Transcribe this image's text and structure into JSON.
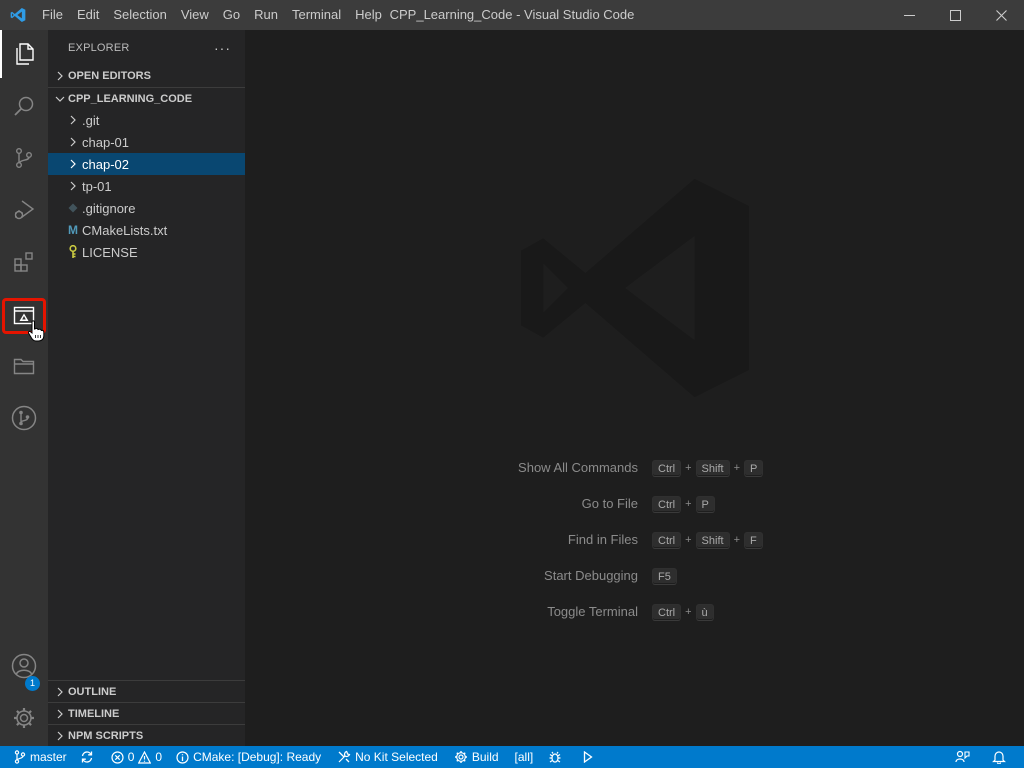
{
  "window": {
    "title": "CPP_Learning_Code - Visual Studio Code"
  },
  "menu": [
    "File",
    "Edit",
    "Selection",
    "View",
    "Go",
    "Run",
    "Terminal",
    "Help"
  ],
  "activitybar": {
    "items": [
      "explorer-icon",
      "search-icon",
      "source-control-icon",
      "run-debug-icon",
      "extensions-icon",
      "cmake-icon",
      "folder-icon",
      "git-graph-icon"
    ],
    "accounts_badge": "1"
  },
  "sidebar": {
    "header": "EXPLORER",
    "more": "···",
    "open_editors": "OPEN EDITORS",
    "folder_name": "CPP_LEARNING_CODE",
    "tree": [
      {
        "label": ".git",
        "kind": "folder"
      },
      {
        "label": "chap-01",
        "kind": "folder"
      },
      {
        "label": "chap-02",
        "kind": "folder",
        "selected": true
      },
      {
        "label": "tp-01",
        "kind": "folder"
      },
      {
        "label": ".gitignore",
        "kind": "file"
      },
      {
        "label": "CMakeLists.txt",
        "kind": "file",
        "icon": "M"
      },
      {
        "label": "LICENSE",
        "kind": "file"
      }
    ],
    "bottom_sections": [
      "OUTLINE",
      "TIMELINE",
      "NPM SCRIPTS"
    ]
  },
  "editor": {
    "shortcuts": [
      {
        "label": "Show All Commands",
        "keys": [
          "Ctrl",
          "Shift",
          "P"
        ]
      },
      {
        "label": "Go to File",
        "keys": [
          "Ctrl",
          "P"
        ]
      },
      {
        "label": "Find in Files",
        "keys": [
          "Ctrl",
          "Shift",
          "F"
        ]
      },
      {
        "label": "Start Debugging",
        "keys": [
          "F5"
        ]
      },
      {
        "label": "Toggle Terminal",
        "keys": [
          "Ctrl",
          "ù"
        ]
      }
    ],
    "plus": "+"
  },
  "statusbar": {
    "branch": "master",
    "errors": "0",
    "warnings": "0",
    "cmake_status": "CMake: [Debug]: Ready",
    "kit": "No Kit Selected",
    "build": "Build",
    "target": "[all]"
  },
  "colors": {
    "accent": "#007acc",
    "selection": "#094771",
    "highlight_box": "#e51400"
  }
}
